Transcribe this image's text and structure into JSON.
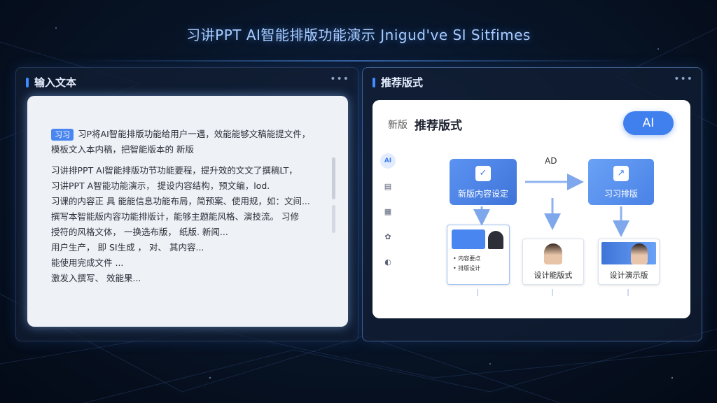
{
  "page": {
    "title": "习讲PPT AI智能排版功能演示  Jnigud've SI Sitfimes"
  },
  "left_panel": {
    "title": "输入文本",
    "tag": "习习",
    "lines": [
      "习P将AI智能排版功能给用户一遇，效能能够文稿能提文件，",
      "模板文入本内稿，把智能版本的 新版",
      "习讲排PPT AI智能排版功节功能要程，提升效的文文了撰稿LT，",
      "习讲PPT A智能功能演示， 提设内容结构，预文编，lod.",
      "习课的内容正 具 能能信息功能布局，简预案、使用规，如：文间...",
      "撰写本智能版内容功能排版计，能够主题能风格、演技流。 习修",
      "授符的风格文体， 一换选布版，  纸版.  新闻...",
      "用户生产，  即 SI生成 ，  对、  其内容...",
      "能使用完成文件 ...",
      "激发入撰写、 效能果..."
    ]
  },
  "right_panel": {
    "title": "推荐版式",
    "canvas": {
      "subtitle": "新版",
      "title": "推荐版式",
      "ai_button": "AI"
    },
    "tools": [
      {
        "icon": "ai-icon",
        "glyph": "AI"
      },
      {
        "icon": "layout-icon",
        "glyph": "▤"
      },
      {
        "icon": "document-icon",
        "glyph": "▦"
      },
      {
        "icon": "settings-icon",
        "glyph": "✿"
      },
      {
        "icon": "palette-icon",
        "glyph": "◐"
      }
    ],
    "flow": {
      "node_a": "新版内容设定",
      "node_b": "习习排版",
      "arrow_label": "AD"
    },
    "thumbnails": [
      {
        "label": "",
        "sub": "• 内容要点",
        "sub2": "• 排版设计"
      },
      {
        "label": "设计能版式"
      },
      {
        "label": "设计演示版"
      }
    ],
    "accent_color": "#3f7fee"
  }
}
